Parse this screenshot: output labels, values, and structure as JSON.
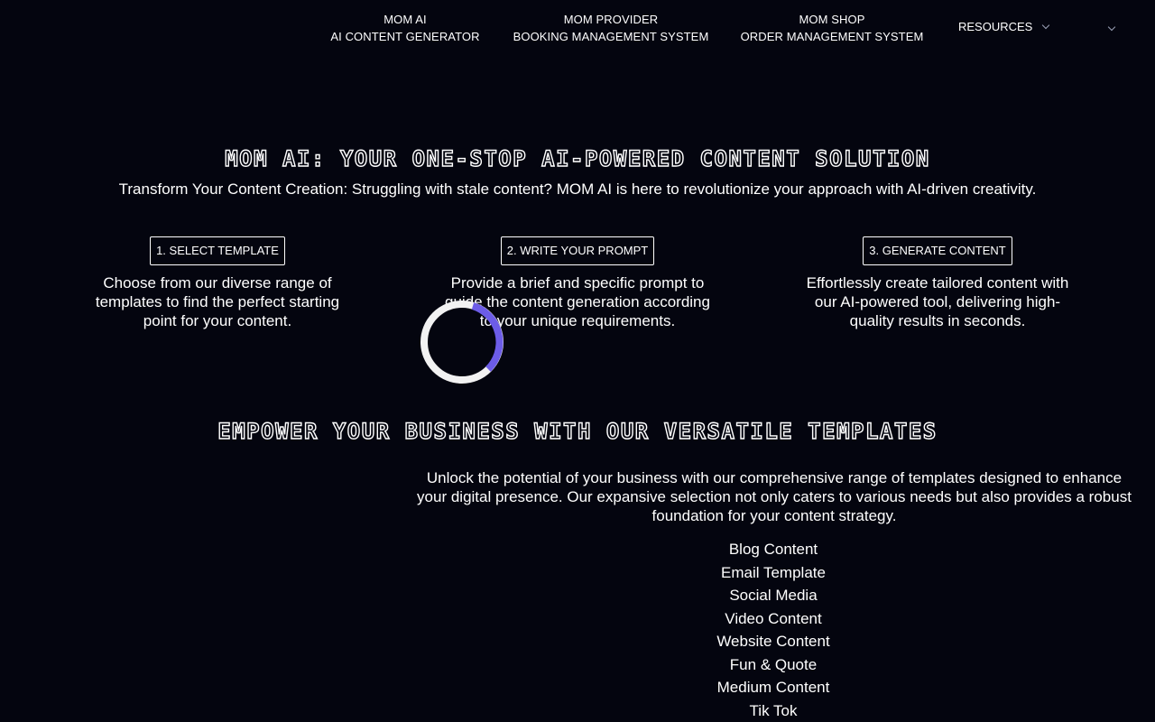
{
  "nav": {
    "items": [
      {
        "line1": "MOM AI",
        "line2": "AI CONTENT GENERATOR"
      },
      {
        "line1": "MOM PROVIDER",
        "line2": "BOOKING MANAGEMENT SYSTEM"
      },
      {
        "line1": "MOM SHOP",
        "line2": "ORDER MANAGEMENT SYSTEM"
      }
    ],
    "resources_label": "RESOURCES",
    "icons": [
      "chevron-down-icon"
    ]
  },
  "hero": {
    "title": "MOM AI: YOUR ONE-STOP AI-POWERED CONTENT SOLUTION",
    "subtitle": "Transform Your Content Creation: Struggling with stale content? MOM AI is here to revolutionize your approach with AI-driven creativity."
  },
  "steps": [
    {
      "label": "1. SELECT TEMPLATE",
      "description": "Choose from our diverse range of templates to find the perfect starting point for your content."
    },
    {
      "label": "2. WRITE YOUR PROMPT",
      "description": "Provide a brief and specific prompt to guide the content generation according to your unique requirements."
    },
    {
      "label": "3. GENERATE CONTENT",
      "description": "Effortlessly create tailored content with our AI-powered tool, delivering high-quality results in seconds."
    }
  ],
  "templates": {
    "title": "EMPOWER YOUR BUSINESS WITH OUR VERSATILE TEMPLATES",
    "intro": "Unlock the potential of your business with our comprehensive range of templates designed to enhance your digital presence. Our expansive selection not only caters to various needs but also provides a robust foundation for your content strategy.",
    "list": [
      "Blog Content",
      "Email Template",
      "Social Media",
      "Video Content",
      "Website Content",
      "Fun & Quote",
      "Medium Content",
      "Tik Tok"
    ]
  },
  "colors": {
    "background": "#04050f",
    "text": "#ffffff",
    "spinner_track": "#f2f2f2",
    "spinner_accent": "#6c5ce7"
  }
}
